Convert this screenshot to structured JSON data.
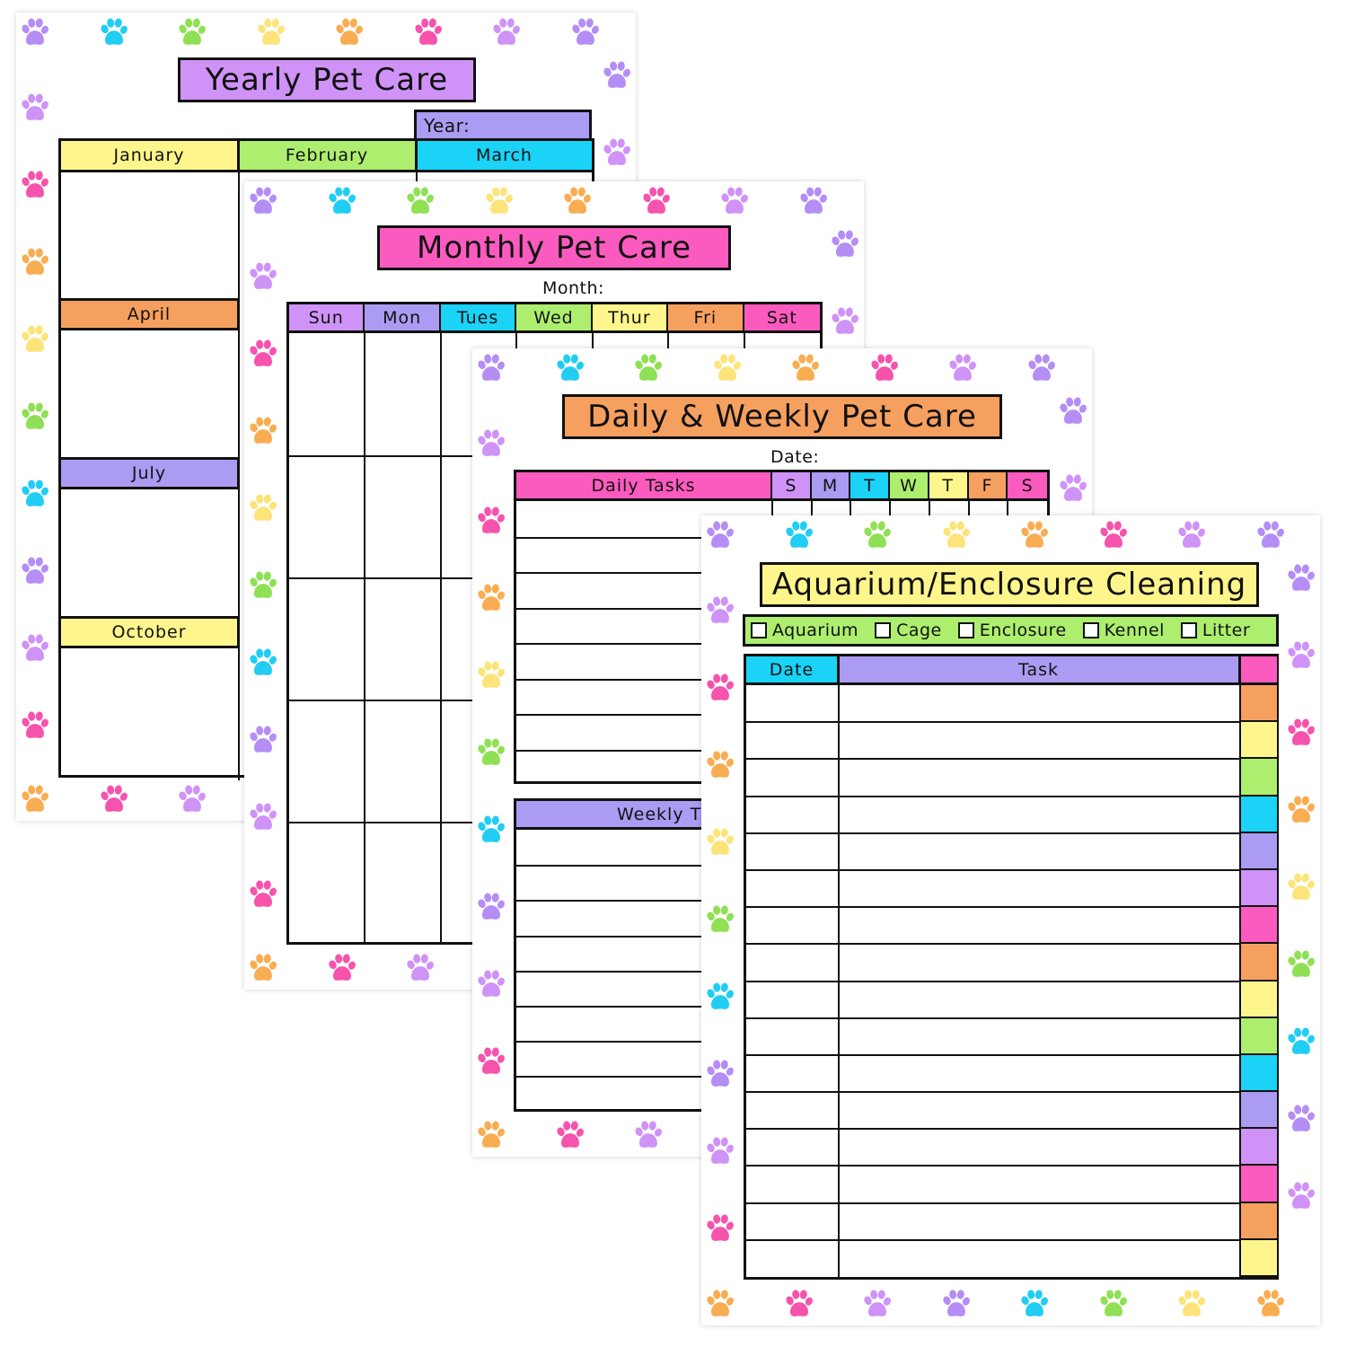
{
  "colors": {
    "purple": "#cf93f7",
    "lavender": "#ab9bf2",
    "blue": "#1ad3f7",
    "green": "#adee6f",
    "yellow": "#fef68c",
    "orange": "#f6a05f",
    "pink": "#fb5bbf",
    "paw_purple": "#b48ef5",
    "paw_blue": "#22cdf3",
    "paw_green": "#8fe055",
    "paw_yellow": "#fde47a",
    "paw_orange": "#f9ad52",
    "paw_pink": "#f653ad",
    "paw_violet": "#cf93f7"
  },
  "paw_icon": "paw-print-icon",
  "sheets": {
    "yearly": {
      "title": "Yearly Pet Care",
      "year_label": "Year:",
      "months": [
        "January",
        "February",
        "March",
        "April",
        "July",
        "October"
      ]
    },
    "monthly": {
      "title": "Monthly Pet Care",
      "month_label": "Month:",
      "days": [
        "Sun",
        "Mon",
        "Tues",
        "Wed",
        "Thur",
        "Fri",
        "Sat"
      ]
    },
    "daily_weekly": {
      "title": "Daily & Weekly Pet Care",
      "date_label": "Date:",
      "daily_header": "Daily Tasks",
      "day_letters": [
        "S",
        "M",
        "T",
        "W",
        "T",
        "F",
        "S"
      ],
      "weekly_header": "Weekly T"
    },
    "aquarium": {
      "title": "Aquarium/Enclosure Cleaning",
      "options": [
        {
          "label": "Aquarium",
          "checked": false
        },
        {
          "label": "Cage",
          "checked": false
        },
        {
          "label": "Enclosure",
          "checked": false
        },
        {
          "label": "Kennel",
          "checked": false
        },
        {
          "label": "Litter",
          "checked": false
        }
      ],
      "date_header": "Date",
      "task_header": "Task",
      "row_count": 16
    }
  }
}
